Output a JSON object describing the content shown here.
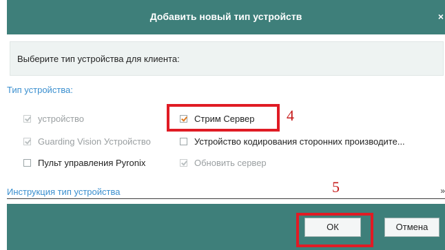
{
  "dialog": {
    "title": "Добавить новый тип устройств",
    "close_glyph": "×",
    "prompt": "Выберите тип устройства для клиента:",
    "device_type_label": "Тип устройства:",
    "device_types": [
      {
        "label": "устройство",
        "checked": true,
        "disabled": true
      },
      {
        "label": "Стрим Сервер",
        "checked": true,
        "disabled": false
      },
      {
        "label": "Guarding Vision Устройство",
        "checked": true,
        "disabled": true
      },
      {
        "label": "Устройство кодирования сторонних производите...",
        "checked": false,
        "disabled": false
      },
      {
        "label": "Пульт управления Pyronix",
        "checked": false,
        "disabled": false
      },
      {
        "label": "Обновить сервер",
        "checked": true,
        "disabled": true
      }
    ],
    "instruction_label": "Инструкция тип устройства",
    "expand_icon": "double-chevron-down-icon",
    "ok_label": "ОК",
    "cancel_label": "Отмена"
  },
  "annotations": {
    "step4": "4",
    "step5": "5"
  },
  "colors": {
    "header": "#3e7f7a",
    "highlight": "#e01b24",
    "link": "#3a8fcf",
    "checkmark": "#e07a1e"
  }
}
